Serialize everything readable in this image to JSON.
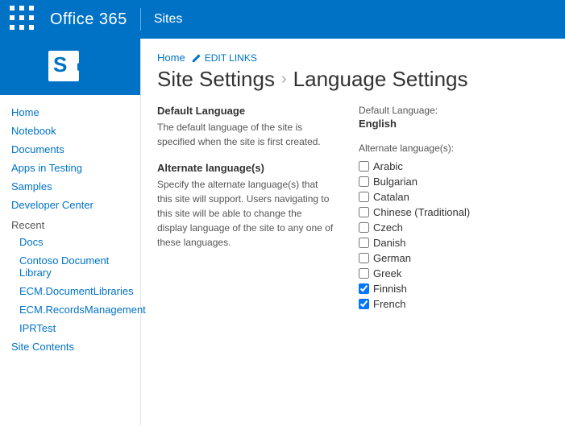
{
  "topbar": {
    "title": "Office 365",
    "divider": true,
    "sites": "Sites"
  },
  "sidebar": {
    "nav_items": [
      {
        "label": "Home",
        "sub": false
      },
      {
        "label": "Notebook",
        "sub": false
      },
      {
        "label": "Documents",
        "sub": false
      },
      {
        "label": "Apps in Testing",
        "sub": false
      },
      {
        "label": "Samples",
        "sub": false
      },
      {
        "label": "Developer Center",
        "sub": false
      },
      {
        "label": "Recent",
        "sub": false,
        "is_section": true
      },
      {
        "label": "Docs",
        "sub": true
      },
      {
        "label": "Contoso Document Library",
        "sub": true
      },
      {
        "label": "ECM.DocumentLibraries",
        "sub": true
      },
      {
        "label": "ECM.RecordsManagement",
        "sub": true
      },
      {
        "label": "IPRTest",
        "sub": true
      },
      {
        "label": "Site Contents",
        "sub": false
      }
    ]
  },
  "breadcrumb": {
    "home": "Home",
    "edit_links": "EDIT LINKS"
  },
  "page": {
    "title_main": "Site Settings",
    "title_arrow": "›",
    "title_sub": "Language Settings"
  },
  "default_language_section": {
    "title": "Default Language",
    "description": "The default language of the site is specified when the site is first created."
  },
  "alternate_language_section": {
    "title": "Alternate language(s)",
    "description": "Specify the alternate language(s) that this site will support. Users navigating to this site will be able to change the display language of the site to any one of these languages."
  },
  "right_panel": {
    "default_lang_label": "Default Language:",
    "default_lang_value": "English",
    "alt_lang_label": "Alternate language(s):",
    "languages": [
      {
        "label": "Arabic",
        "checked": false
      },
      {
        "label": "Bulgarian",
        "checked": false
      },
      {
        "label": "Catalan",
        "checked": false
      },
      {
        "label": "Chinese (Traditional)",
        "checked": false
      },
      {
        "label": "Czech",
        "checked": false
      },
      {
        "label": "Danish",
        "checked": false
      },
      {
        "label": "German",
        "checked": false
      },
      {
        "label": "Greek",
        "checked": false
      },
      {
        "label": "Finnish",
        "checked": true
      },
      {
        "label": "French",
        "checked": true
      }
    ]
  }
}
